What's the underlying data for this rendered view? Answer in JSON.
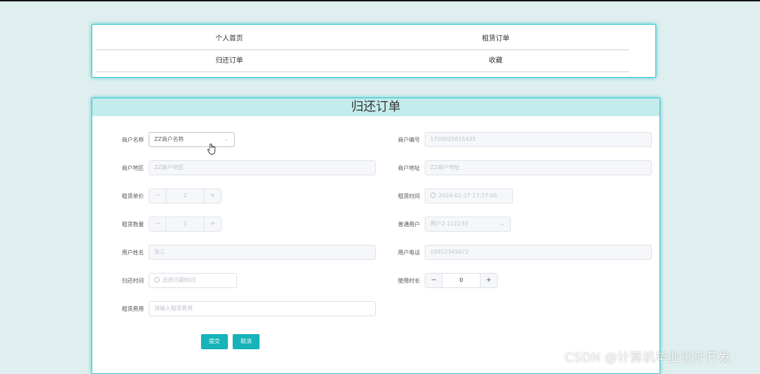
{
  "nav": {
    "items": [
      "个人首页",
      "租赁订单",
      "归还订单",
      "收藏"
    ]
  },
  "form": {
    "title": "归还订单",
    "merchant_name": {
      "label": "商户名称",
      "value": "ZZ商户名称"
    },
    "merchant_no": {
      "label": "商户编号",
      "value": "1709025815435"
    },
    "merchant_region": {
      "label": "商户地区",
      "value": "ZZ商户地区"
    },
    "merchant_address": {
      "label": "商户地址",
      "value": "ZZ商户地址"
    },
    "unit_price": {
      "label": "租赁单价",
      "value": "2"
    },
    "rent_time": {
      "label": "租赁时间",
      "value": "2024-02-27 17:27:00"
    },
    "quantity": {
      "label": "租赁数量",
      "value": "1"
    },
    "normal_user": {
      "label": "普通用户",
      "value": "用户2-112233"
    },
    "user_name": {
      "label": "用户姓名",
      "value": "张三"
    },
    "user_phone": {
      "label": "用户电话",
      "value": "18912345672"
    },
    "return_time": {
      "label": "归还时间",
      "placeholder": "选择日期时间"
    },
    "use_duration": {
      "label": "使用时长",
      "value": "0"
    },
    "fee": {
      "label": "租赁费用",
      "placeholder": "请输入租赁费用"
    },
    "submit_label": "提交",
    "cancel_label": "取消"
  },
  "stepper_symbols": {
    "minus": "−",
    "plus": "+"
  },
  "watermark": "CSDN @计算机毕业设计开发",
  "colors": {
    "accent": "#17b3b8",
    "card_border": "#37c6cc",
    "title_bg": "#c4ecec",
    "page_bg": "#dfeeee"
  }
}
